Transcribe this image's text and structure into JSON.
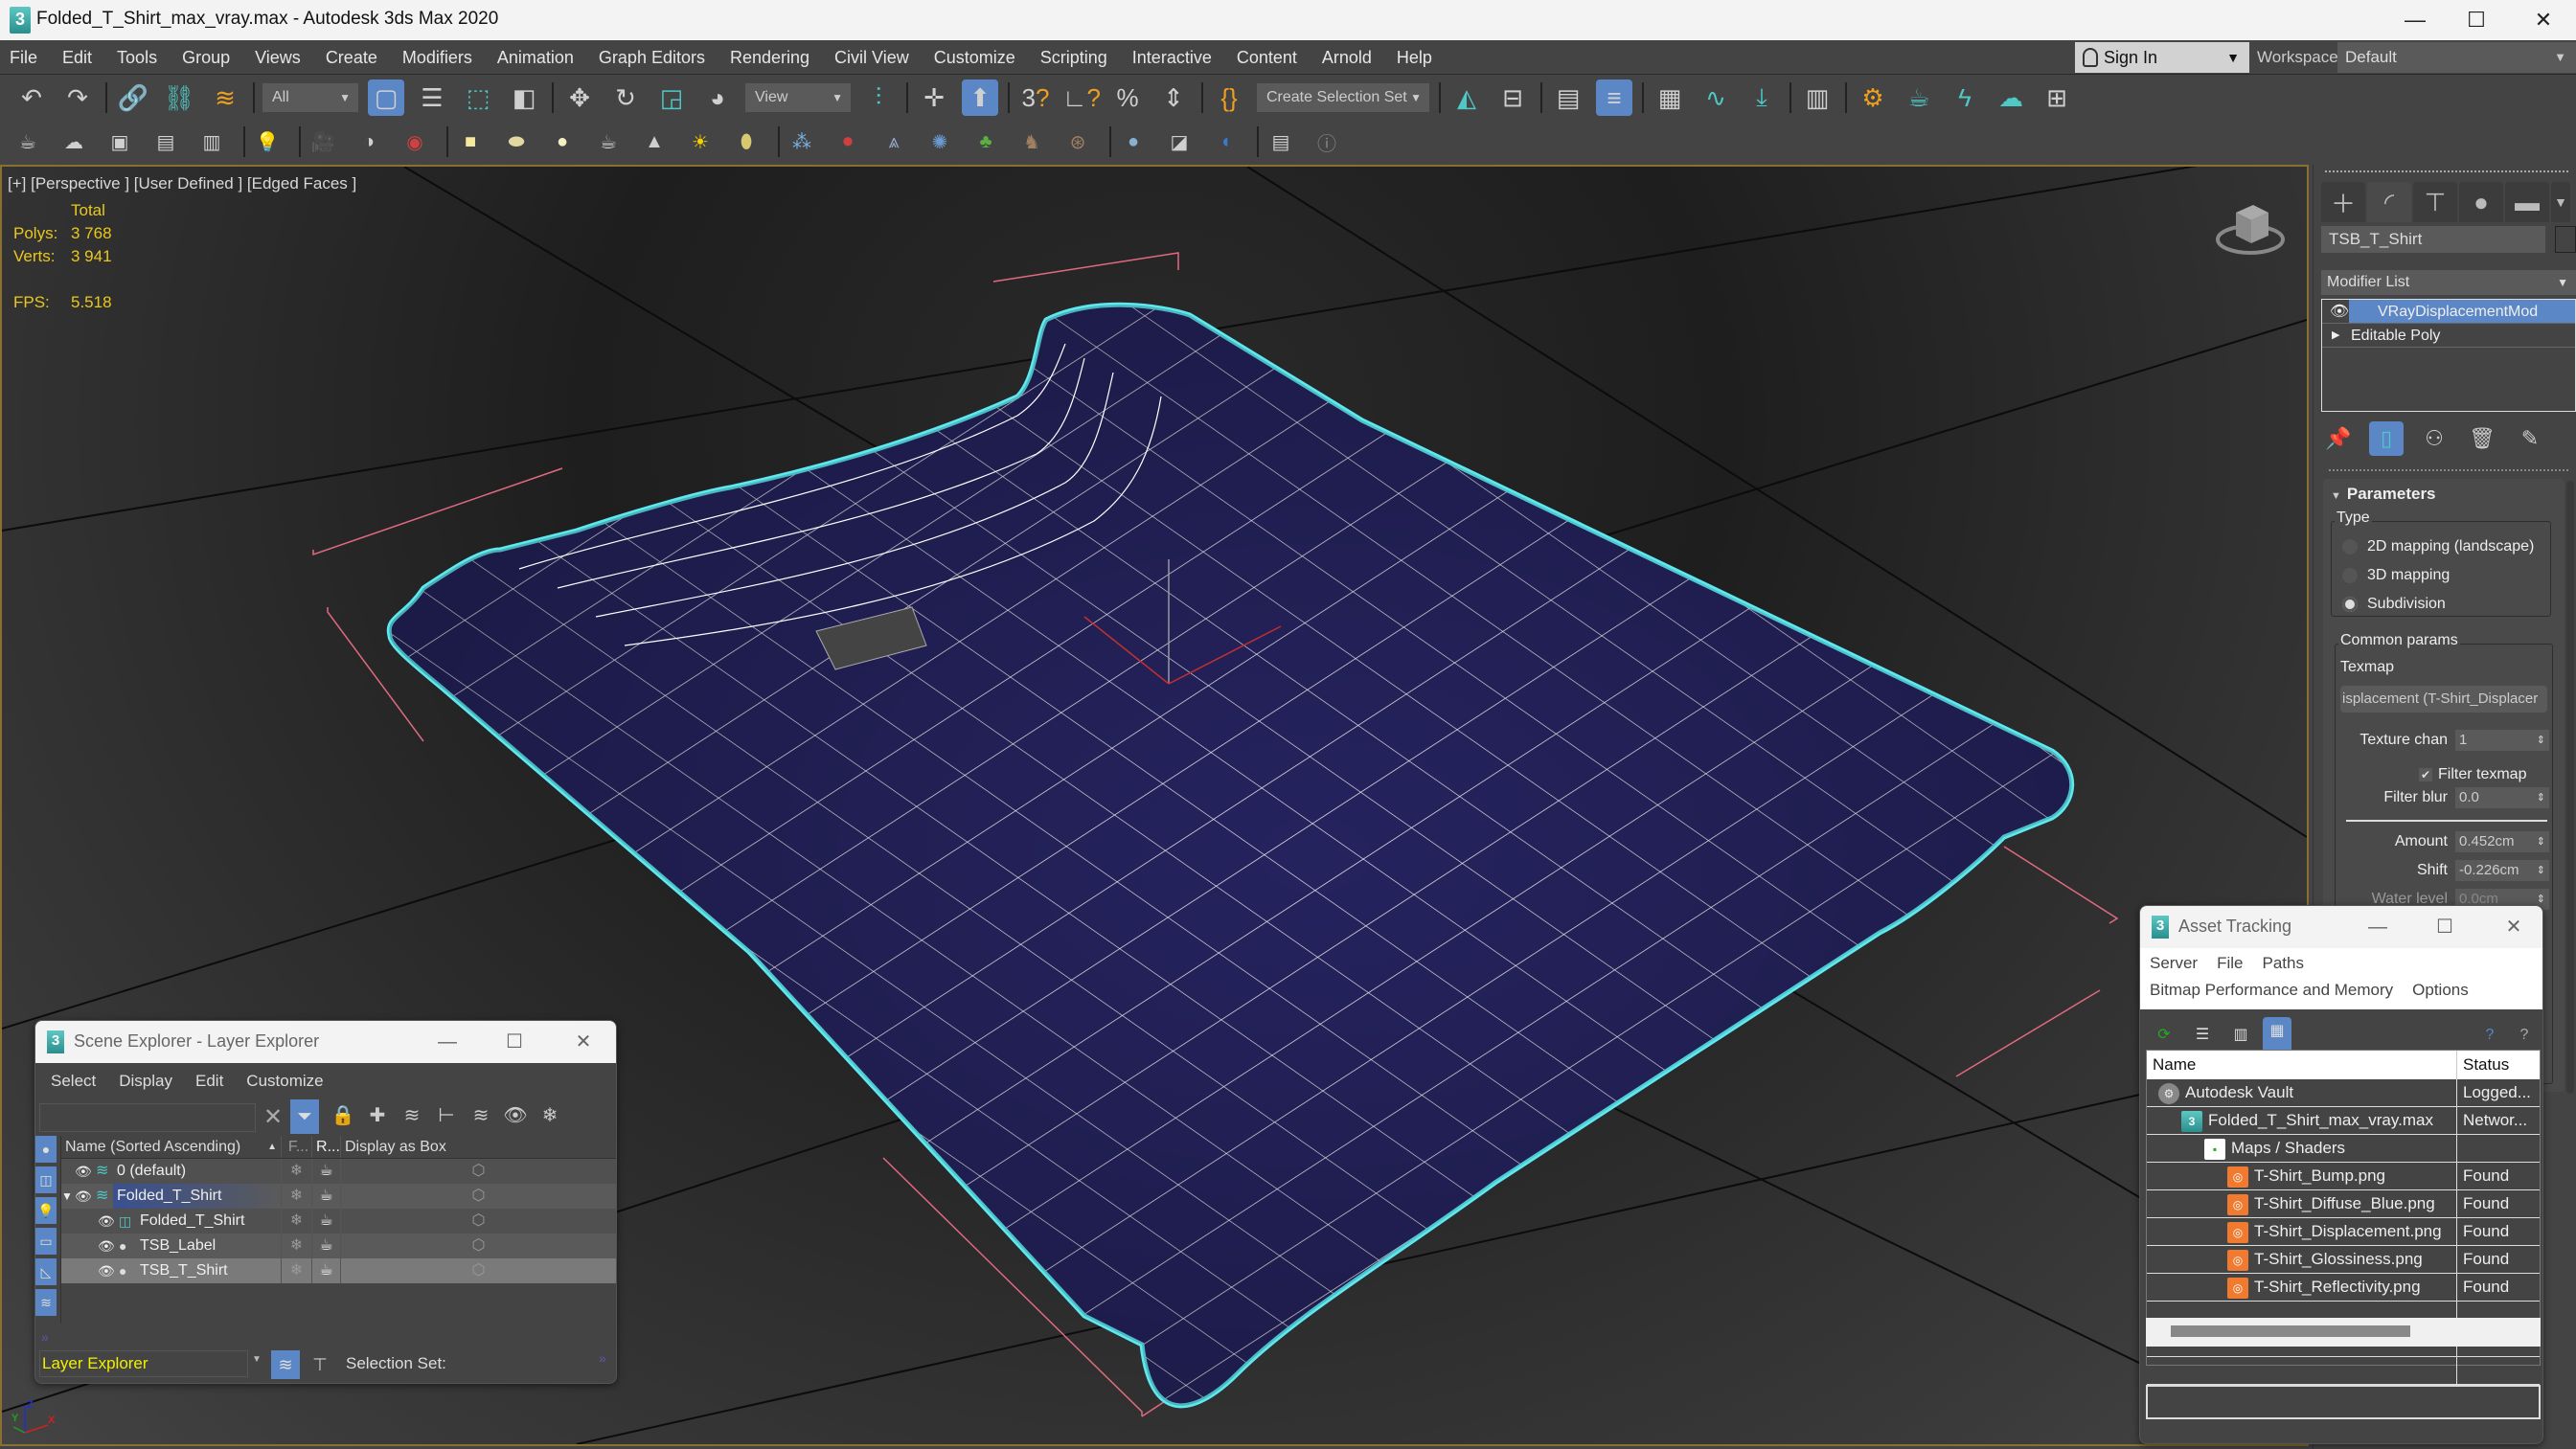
{
  "window": {
    "title": "Folded_T_Shirt_max_vray.max - Autodesk 3ds Max 2020",
    "app_icon": "3",
    "minimize": "—",
    "maximize": "☐",
    "close": "✕"
  },
  "menubar": {
    "items": [
      "File",
      "Edit",
      "Tools",
      "Group",
      "Views",
      "Create",
      "Modifiers",
      "Animation",
      "Graph Editors",
      "Rendering",
      "Civil View",
      "Customize",
      "Scripting",
      "Interactive",
      "Content",
      "Arnold",
      "Help"
    ],
    "sign_in": "Sign In",
    "workspaces_label": "Workspaces:",
    "workspace_value": "Default"
  },
  "toolbar": {
    "selection_filter": "All",
    "reference_coord": "View",
    "selection_set_placeholder": "Create Selection Set",
    "icons_row1": [
      "undo-icon",
      "redo-icon",
      "link-icon",
      "unlink-icon",
      "bind-spacewarp-icon",
      "select-object-icon",
      "select-by-name-icon",
      "rect-selection-icon",
      "window-crossing-icon",
      "move-icon",
      "rotate-icon",
      "scale-icon",
      "placement-icon",
      "pivot-icon",
      "keyboard-shortcut-override-icon",
      "snap-toggle-icon",
      "angle-snap-icon",
      "percent-snap-icon",
      "spinner-snap-icon",
      "edit-named-selection-icon",
      "mirror-icon",
      "align-icon",
      "scene-explorer-icon",
      "layer-explorer-icon",
      "ribbon-icon",
      "curve-editor-icon",
      "schematic-view-icon",
      "material-editor-icon",
      "render-setup-icon",
      "rendered-frame-window-icon",
      "render-production-icon",
      "render-cloud-icon",
      "viewport-layout-icon"
    ],
    "icons_row2": [
      "teapot-icon",
      "plane-icon",
      "render-frame-icon",
      "vray-frame-buffer-icon",
      "vray-settings-icon",
      "vray-light-lister-icon",
      "vray-camera-icon",
      "vray-dome-camera-icon",
      "vray-physical-camera-icon",
      "vray-plane-light-icon",
      "vray-sphere-light-icon",
      "vray-disk-light-icon",
      "vray-mesh-light-icon",
      "vray-ies-light-icon",
      "vray-sun-icon",
      "vray-ambient-light-icon",
      "vray-proxy-icon",
      "vray-instancer-icon",
      "vray-fur-icon",
      "vray-scatter-icon",
      "vray-grass-icon",
      "vray-hair-icon",
      "vray-ox-icon",
      "vray-sphere-icon",
      "vray-material-icon",
      "vray-clipper-icon",
      "vray-scene-converter-icon",
      "help-icon"
    ]
  },
  "viewport": {
    "label": "[+] [Perspective ] [User Defined ] [Edged Faces ]",
    "stats": {
      "total_label": "Total",
      "polys_label": "Polys:",
      "polys_value": "3 768",
      "verts_label": "Verts:",
      "verts_value": "3 941",
      "fps_label": "FPS:",
      "fps_value": "5.518"
    },
    "axis": {
      "x": "X",
      "y": "Y",
      "z": "Z"
    }
  },
  "command_panel": {
    "tabs": [
      "create-tab",
      "modify-tab",
      "hierarchy-tab",
      "motion-tab",
      "display-tab",
      "utilities-tab"
    ],
    "object_name": "TSB_T_Shirt",
    "modifier_list": "Modifier List",
    "stack": [
      {
        "label": "VRayDisplacementMod",
        "selected": true
      },
      {
        "label": "Editable Poly",
        "selected": false
      }
    ],
    "parameters": {
      "title": "Parameters",
      "type_label": "Type",
      "types": [
        {
          "label": "2D mapping (landscape)",
          "checked": false
        },
        {
          "label": "3D mapping",
          "checked": false
        },
        {
          "label": "Subdivision",
          "checked": true
        }
      ],
      "common_label": "Common params",
      "texmap_label": "Texmap",
      "texmap_value": "isplacement (T-Shirt_Displacer",
      "texture_chan_label": "Texture chan",
      "texture_chan_value": "1",
      "filter_texmap_label": "Filter texmap",
      "filter_texmap_checked": true,
      "filter_blur_label": "Filter blur",
      "filter_blur_value": "0.0",
      "amount_label": "Amount",
      "amount_value": "0.452cm",
      "shift_label": "Shift",
      "shift_value": "-0.226cm",
      "water_level_label": "Water level",
      "water_level_value": "0.0cm"
    }
  },
  "scene_explorer": {
    "title": "Scene Explorer - Layer Explorer",
    "menu": [
      "Select",
      "Display",
      "Edit",
      "Customize"
    ],
    "columns": [
      "Name (Sorted Ascending)",
      "F...",
      "R...",
      "Display as Box"
    ],
    "rows": [
      {
        "name": "0 (default)",
        "type": "layer",
        "level": 0
      },
      {
        "name": "Folded_T_Shirt",
        "type": "layer",
        "level": 0,
        "expanded": true,
        "highlighted": true
      },
      {
        "name": "Folded_T_Shirt",
        "type": "group",
        "level": 1
      },
      {
        "name": "TSB_Label",
        "type": "object",
        "level": 1
      },
      {
        "name": "TSB_T_Shirt",
        "type": "object",
        "level": 1,
        "selected": true
      }
    ],
    "mode": "Layer Explorer",
    "selection_set_label": "Selection Set:"
  },
  "asset_tracking": {
    "title": "Asset Tracking",
    "menu_row1": [
      "Server",
      "File",
      "Paths"
    ],
    "menu_row2": [
      "Bitmap Performance and Memory",
      "Options"
    ],
    "columns": [
      "Name",
      "Status"
    ],
    "rows": [
      {
        "name": "Autodesk Vault",
        "status": "Logged...",
        "icon": "vault",
        "level": 0
      },
      {
        "name": "Folded_T_Shirt_max_vray.max",
        "status": "Networ...",
        "icon": "max",
        "level": 1
      },
      {
        "name": "Maps / Shaders",
        "status": "",
        "icon": "maps",
        "level": 2
      },
      {
        "name": "T-Shirt_Bump.png",
        "status": "Found",
        "icon": "png",
        "level": 3
      },
      {
        "name": "T-Shirt_Diffuse_Blue.png",
        "status": "Found",
        "icon": "png",
        "level": 3
      },
      {
        "name": "T-Shirt_Displacement.png",
        "status": "Found",
        "icon": "png",
        "level": 3
      },
      {
        "name": "T-Shirt_Glossiness.png",
        "status": "Found",
        "icon": "png",
        "level": 3
      },
      {
        "name": "T-Shirt_Reflectivity.png",
        "status": "Found",
        "icon": "png",
        "level": 3
      },
      {
        "name": "",
        "status": "",
        "icon": "",
        "level": 0
      },
      {
        "name": "",
        "status": "",
        "icon": "",
        "level": 0
      },
      {
        "name": "",
        "status": "",
        "icon": "",
        "level": 0
      }
    ]
  },
  "colors": {
    "accent": "#5b87c7",
    "teal": "#4ec9c5",
    "selection_outline": "#5ee8f0",
    "stats_yellow": "#e9c81e",
    "shirt": "#25235e",
    "viewport_border": "#8a7030"
  }
}
